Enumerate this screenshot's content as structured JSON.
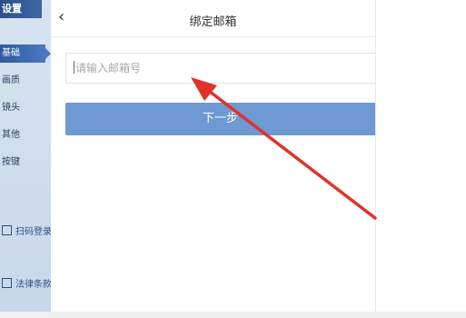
{
  "sidebar": {
    "title": "设置",
    "items": [
      {
        "label": "基础",
        "active": true
      },
      {
        "label": "画质",
        "active": false
      },
      {
        "label": "镜头",
        "active": false
      },
      {
        "label": "其他",
        "active": false
      },
      {
        "label": "按键",
        "active": false
      }
    ],
    "scan_login": "扫码登录",
    "legal_terms": "法律条款"
  },
  "dialog": {
    "back_icon": "chevron-left-icon",
    "title": "绑定邮箱",
    "email_placeholder": "请输入邮箱号",
    "next_button": "下一步"
  },
  "colors": {
    "button": "#6e99d2",
    "annotation_arrow": "#e0322a",
    "sidebar_active": "#2f5aa0"
  }
}
